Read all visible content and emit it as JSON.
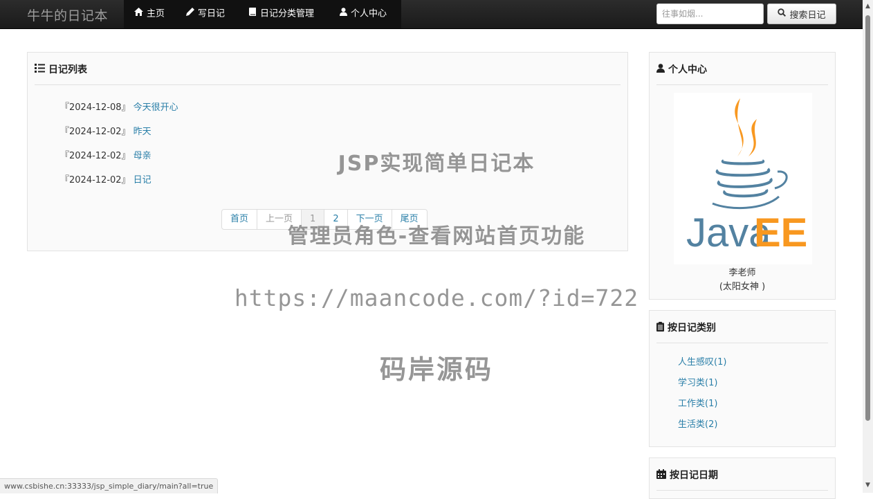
{
  "navbar": {
    "brand": "牛牛的日记本",
    "items": [
      {
        "label": "主页",
        "icon": "home-icon"
      },
      {
        "label": "写日记",
        "icon": "pencil-icon"
      },
      {
        "label": "日记分类管理",
        "icon": "book-icon"
      },
      {
        "label": "个人中心",
        "icon": "user-icon"
      }
    ],
    "search_placeholder": "往事如烟...",
    "search_button": "搜索日记"
  },
  "diary_panel": {
    "title": "日记列表",
    "entries": [
      {
        "date": "『2024-12-08』",
        "title": "今天很开心"
      },
      {
        "date": "『2024-12-02』",
        "title": "昨天"
      },
      {
        "date": "『2024-12-02』",
        "title": "母亲"
      },
      {
        "date": "『2024-12-02』",
        "title": "日记"
      }
    ],
    "pagination": {
      "first": "首页",
      "prev": "上一页",
      "pages": [
        "1",
        "2"
      ],
      "current_page": "1",
      "next": "下一页",
      "last": "尾页"
    }
  },
  "profile_panel": {
    "title": "个人中心",
    "logo_text_java": "Java",
    "logo_text_ee": "EE",
    "name": "李老师",
    "motto": "(太阳女神 )"
  },
  "category_panel": {
    "title": "按日记类别",
    "categories": [
      "人生感叹(1)",
      "学习类(1)",
      "工作类(1)",
      "生活类(2)"
    ]
  },
  "date_panel": {
    "title": "按日记日期"
  },
  "watermark": {
    "line1": "JSP实现简单日记本",
    "line2": "管理员角色-查看网站首页功能",
    "line3": "https://maancode.com/?id=722",
    "line4": "码岸源码"
  },
  "status_bar": {
    "url": "www.csbishe.cn:33333/jsp_simple_diary/main?all=true"
  },
  "colors": {
    "navbar_bg": "#1a1a1a",
    "link": "#2a7fa8",
    "java_blue": "#5382a1",
    "java_orange": "#f89820"
  }
}
